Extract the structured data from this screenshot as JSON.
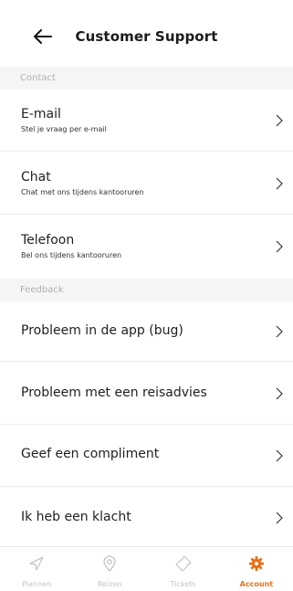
{
  "header": {
    "title": "Customer Support"
  },
  "sections": [
    {
      "label": "Contact"
    },
    {
      "label": "Feedback"
    }
  ],
  "contact_items": [
    {
      "title": "E-mail",
      "subtitle": "Stel je vraag per e-mail"
    },
    {
      "title": "Chat",
      "subtitle": "Chat met ons tijdens kantooruren"
    },
    {
      "title": "Telefoon",
      "subtitle": "Bel ons tijdens kantooruren"
    }
  ],
  "feedback_items": [
    {
      "title": "Probleem in de app (bug)"
    },
    {
      "title": "Probleem met een reisadvies"
    },
    {
      "title": "Geef een compliment"
    },
    {
      "title": "Ik heb een klacht"
    }
  ],
  "nav": {
    "items": [
      {
        "label": "Plannen",
        "icon": "navigation-icon",
        "active": false
      },
      {
        "label": "Reizen",
        "icon": "location-pin-icon",
        "active": false
      },
      {
        "label": "Tickets",
        "icon": "ticket-icon",
        "active": false
      },
      {
        "label": "Account",
        "icon": "gear-icon",
        "active": true
      }
    ]
  },
  "colors": {
    "accent": "#e8711a",
    "inactive": "#c4c4c4",
    "section_bg": "#f5f5f5"
  }
}
